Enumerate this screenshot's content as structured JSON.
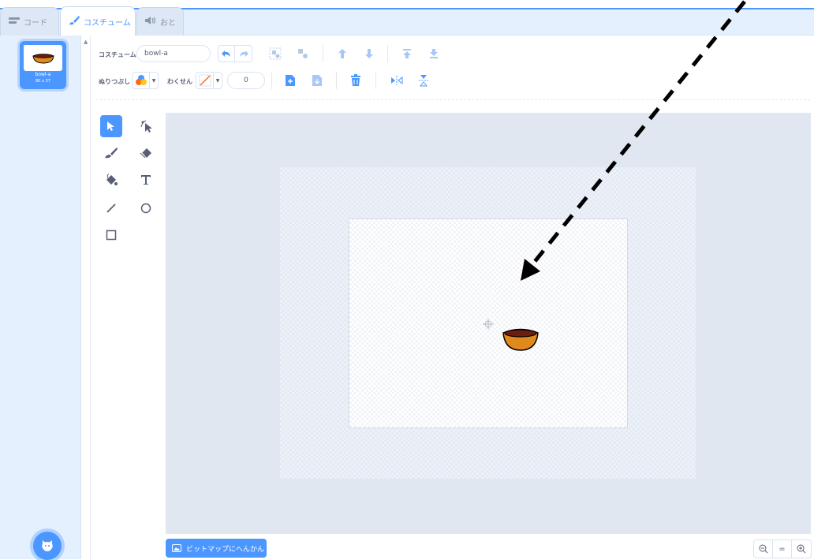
{
  "tabs": [
    {
      "label": "コード",
      "icon": "code-icon"
    },
    {
      "label": "コスチューム",
      "icon": "brush-icon"
    },
    {
      "label": "おと",
      "icon": "sound-icon"
    }
  ],
  "costume_list": [
    {
      "index": "1",
      "name": "bowl-a",
      "size": "80 x 37"
    }
  ],
  "toolbar": {
    "costume_label": "コスチューム",
    "costume_name": "bowl-a",
    "fill_label": "ぬりつぶし",
    "outline_label": "わくせん",
    "outline_width": "0",
    "undo_icon": "undo-icon",
    "redo_icon": "redo-icon",
    "group_icon": "group-icon",
    "ungroup_icon": "ungroup-icon",
    "forward_icon": "forward-icon",
    "backward_icon": "backward-icon",
    "front_icon": "front-icon",
    "back_icon": "back-icon",
    "copy_icon": "copy-icon",
    "paste_icon": "paste-icon",
    "delete_icon": "delete-icon",
    "flip_h_icon": "flip-horizontal-icon",
    "flip_v_icon": "flip-vertical-icon"
  },
  "tools": [
    "select",
    "reshape",
    "brush",
    "eraser",
    "fill",
    "text",
    "line",
    "circle",
    "rectangle"
  ],
  "active_tool": "select",
  "convert_button": "ビットマップにへんかん",
  "zoom": {
    "out": "zoom-out-icon",
    "reset": "=",
    "in": "zoom-in-icon"
  },
  "colors": {
    "accent": "#4c97ff",
    "bowl_body": "#e08a1e",
    "bowl_inside": "#6b1d0e",
    "arrow": "#000000"
  }
}
